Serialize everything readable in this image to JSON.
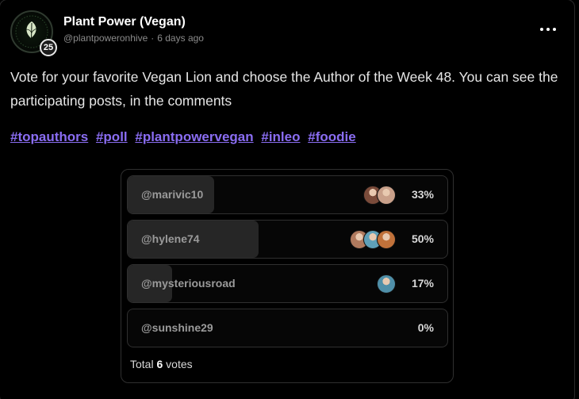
{
  "post": {
    "author_name": "Plant Power (Vegan)",
    "handle": "@plantpoweronhive",
    "separator": "·",
    "time_ago": "6 days ago",
    "reputation": "25",
    "body": "Vote for your favorite Vegan Lion and choose the Author of the Week 48. You can see the participating posts, in the comments",
    "tags": [
      "#topauthors",
      "#poll",
      "#plantpowervegan",
      "#inleo",
      "#foodie"
    ]
  },
  "poll": {
    "options": [
      {
        "label": "@marivic10",
        "percent": "33%",
        "share": 0.33,
        "voter_colors": [
          "#7a4b3a",
          "#c9a08a"
        ]
      },
      {
        "label": "@hylene74",
        "percent": "50%",
        "share": 0.5,
        "voter_colors": [
          "#b07a5e",
          "#5fa0b8",
          "#c0713a"
        ]
      },
      {
        "label": "@mysteriousroad",
        "percent": "17%",
        "share": 0.17,
        "voter_colors": [
          "#4f8fa8"
        ]
      },
      {
        "label": "@sunshine29",
        "percent": "0%",
        "share": 0,
        "voter_colors": []
      }
    ],
    "total_prefix": "Total",
    "total_count": "6",
    "total_suffix": "votes"
  },
  "colors": {
    "background": "#000000",
    "hashtag": "#8a6df2",
    "poll_fill": "#262626"
  }
}
